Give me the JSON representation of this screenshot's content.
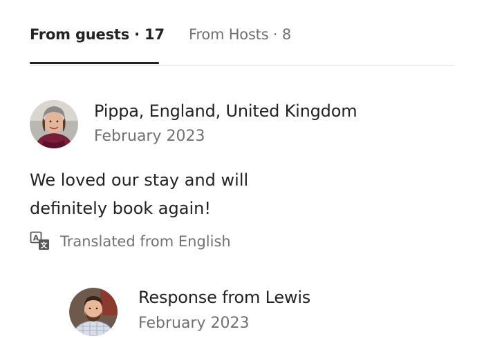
{
  "tabs": [
    {
      "label": "From guests · 17",
      "active": true
    },
    {
      "label": "From Hosts · 8",
      "active": false
    }
  ],
  "review": {
    "author": "Pippa, England, United Kingdom",
    "date": "February 2023",
    "text": "We loved our stay and will definitely book again!",
    "translated_note": "Translated from English",
    "translate_icon": "translate-icon"
  },
  "response": {
    "author": "Response from Lewis",
    "date": "February 2023"
  },
  "colors": {
    "primary_text": "#222222",
    "secondary_text": "#717171",
    "divider": "#dddddd",
    "active_underline": "#222222"
  }
}
